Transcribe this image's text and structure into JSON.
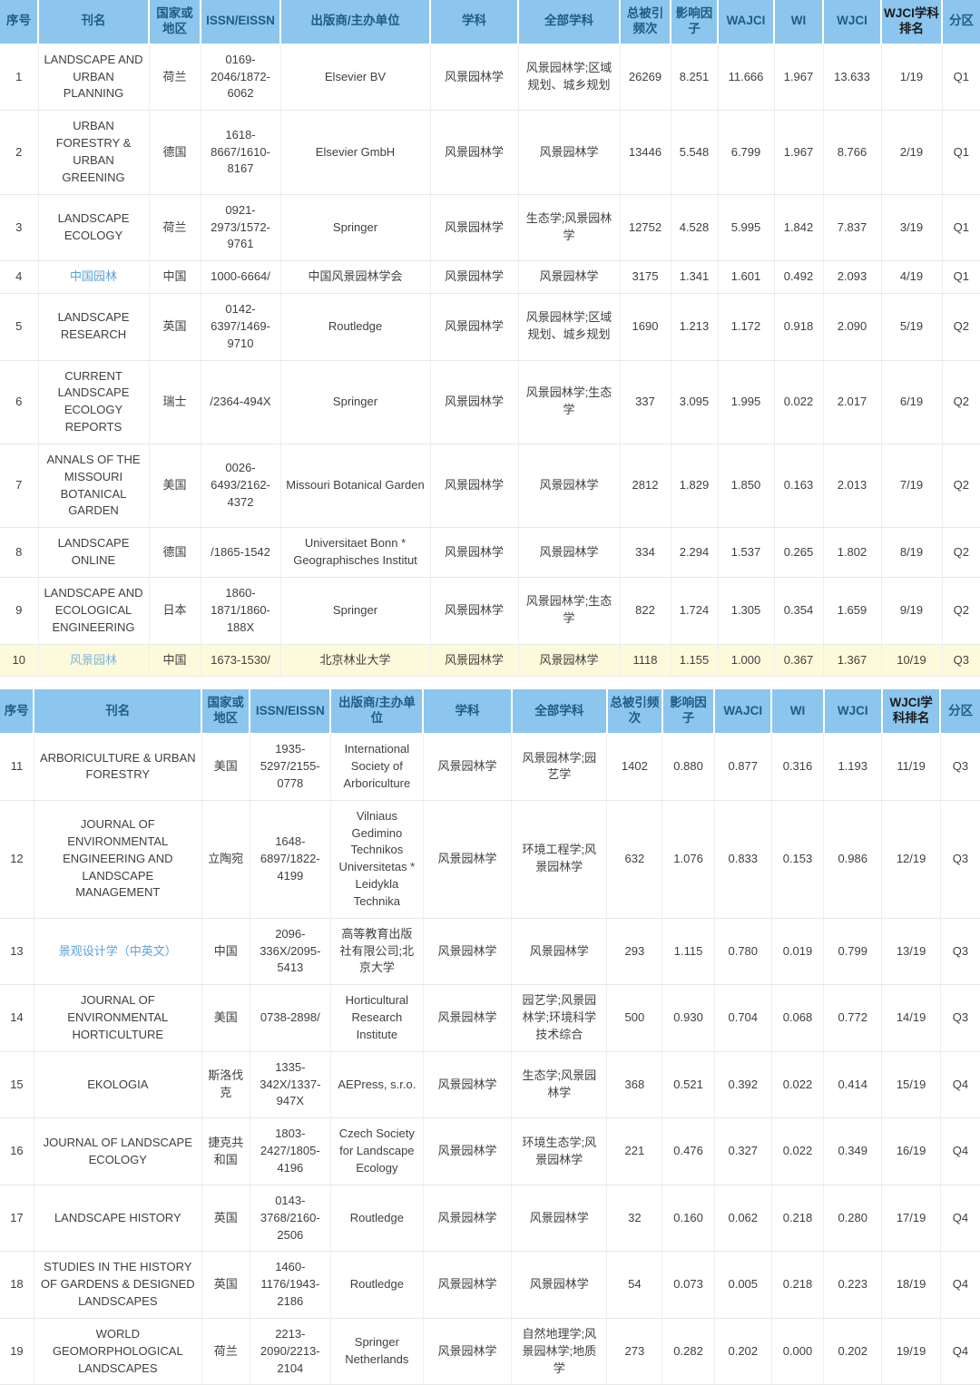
{
  "colors": {
    "header_bg": "#8CC6EE",
    "header_text": "#1F5C86",
    "header_text_dark": "#1a1a1a",
    "journal_link": "#7FB4DC",
    "highlight_row_bg": "#FCFADB",
    "body_text": "#404040",
    "grid_line": "#E8E8E8"
  },
  "tables": [
    {
      "id": "table-part-1",
      "headers": [
        {
          "label": "序号",
          "emphasis": "normal"
        },
        {
          "label": "刊名",
          "emphasis": "normal"
        },
        {
          "label": "国家或地区",
          "emphasis": "normal"
        },
        {
          "label": "ISSN/EISSN",
          "emphasis": "normal"
        },
        {
          "label": "出版商/主办单位",
          "emphasis": "normal"
        },
        {
          "label": "学科",
          "emphasis": "normal"
        },
        {
          "label": "全部学科",
          "emphasis": "normal"
        },
        {
          "label": "总被引频次",
          "emphasis": "normal"
        },
        {
          "label": "影响因子",
          "emphasis": "normal"
        },
        {
          "label": "WAJCI",
          "emphasis": "normal"
        },
        {
          "label": "WI",
          "emphasis": "normal"
        },
        {
          "label": "WJCI",
          "emphasis": "normal"
        },
        {
          "label": "WJCI学科排名",
          "emphasis": "dark"
        },
        {
          "label": "分区",
          "emphasis": "normal"
        }
      ],
      "rows": [
        {
          "highlight": false,
          "rank": "1",
          "journal": "LANDSCAPE AND URBAN PLANNING",
          "journal_lang": "en",
          "country": "荷兰",
          "issn": "0169-2046/1872-6062",
          "publisher": "Elsevier BV",
          "discipline": "风景园林学",
          "all_disciplines": "风景园林学;区域规划、城乡规划",
          "total_citations": "26269",
          "impact_factor": "8.251",
          "wajci": "11.666",
          "wi": "1.967",
          "wjci": "13.633",
          "wjci_rank": "1/19",
          "quartile": "Q1"
        },
        {
          "highlight": false,
          "rank": "2",
          "journal": "URBAN FORESTRY & URBAN GREENING",
          "journal_lang": "en",
          "country": "德国",
          "issn": "1618-8667/1610-8167",
          "publisher": "Elsevier GmbH",
          "discipline": "风景园林学",
          "all_disciplines": "风景园林学",
          "total_citations": "13446",
          "impact_factor": "5.548",
          "wajci": "6.799",
          "wi": "1.967",
          "wjci": "8.766",
          "wjci_rank": "2/19",
          "quartile": "Q1"
        },
        {
          "highlight": false,
          "rank": "3",
          "journal": "LANDSCAPE ECOLOGY",
          "journal_lang": "en",
          "country": "荷兰",
          "issn": "0921-2973/1572-9761",
          "publisher": "Springer",
          "discipline": "风景园林学",
          "all_disciplines": "生态学;风景园林学",
          "total_citations": "12752",
          "impact_factor": "4.528",
          "wajci": "5.995",
          "wi": "1.842",
          "wjci": "7.837",
          "wjci_rank": "3/19",
          "quartile": "Q1"
        },
        {
          "highlight": false,
          "rank": "4",
          "journal": "中国园林",
          "journal_lang": "cn",
          "country": "中国",
          "issn": "1000-6664/",
          "publisher": "中国风景园林学会",
          "discipline": "风景园林学",
          "all_disciplines": "风景园林学",
          "total_citations": "3175",
          "impact_factor": "1.341",
          "wajci": "1.601",
          "wi": "0.492",
          "wjci": "2.093",
          "wjci_rank": "4/19",
          "quartile": "Q1"
        },
        {
          "highlight": false,
          "rank": "5",
          "journal": "LANDSCAPE RESEARCH",
          "journal_lang": "en",
          "country": "英国",
          "issn": "0142-6397/1469-9710",
          "publisher": "Routledge",
          "discipline": "风景园林学",
          "all_disciplines": "风景园林学;区域规划、城乡规划",
          "total_citations": "1690",
          "impact_factor": "1.213",
          "wajci": "1.172",
          "wi": "0.918",
          "wjci": "2.090",
          "wjci_rank": "5/19",
          "quartile": "Q2"
        },
        {
          "highlight": false,
          "rank": "6",
          "journal": "CURRENT LANDSCAPE ECOLOGY REPORTS",
          "journal_lang": "en",
          "country": "瑞士",
          "issn": "/2364-494X",
          "publisher": "Springer",
          "discipline": "风景园林学",
          "all_disciplines": "风景园林学;生态学",
          "total_citations": "337",
          "impact_factor": "3.095",
          "wajci": "1.995",
          "wi": "0.022",
          "wjci": "2.017",
          "wjci_rank": "6/19",
          "quartile": "Q2"
        },
        {
          "highlight": false,
          "rank": "7",
          "journal": "ANNALS OF THE MISSOURI BOTANICAL GARDEN",
          "journal_lang": "en",
          "country": "美国",
          "issn": "0026-6493/2162-4372",
          "publisher": "Missouri Botanical Garden",
          "discipline": "风景园林学",
          "all_disciplines": "风景园林学",
          "total_citations": "2812",
          "impact_factor": "1.829",
          "wajci": "1.850",
          "wi": "0.163",
          "wjci": "2.013",
          "wjci_rank": "7/19",
          "quartile": "Q2"
        },
        {
          "highlight": false,
          "rank": "8",
          "journal": "LANDSCAPE ONLINE",
          "journal_lang": "en",
          "country": "德国",
          "issn": "/1865-1542",
          "publisher": "Universitaet Bonn * Geographisches Institut",
          "discipline": "风景园林学",
          "all_disciplines": "风景园林学",
          "total_citations": "334",
          "impact_factor": "2.294",
          "wajci": "1.537",
          "wi": "0.265",
          "wjci": "1.802",
          "wjci_rank": "8/19",
          "quartile": "Q2"
        },
        {
          "highlight": false,
          "rank": "9",
          "journal": "LANDSCAPE AND ECOLOGICAL ENGINEERING",
          "journal_lang": "en",
          "country": "日本",
          "issn": "1860-1871/1860-188X",
          "publisher": "Springer",
          "discipline": "风景园林学",
          "all_disciplines": "风景园林学;生态学",
          "total_citations": "822",
          "impact_factor": "1.724",
          "wajci": "1.305",
          "wi": "0.354",
          "wjci": "1.659",
          "wjci_rank": "9/19",
          "quartile": "Q2"
        },
        {
          "highlight": true,
          "rank": "10",
          "journal": "风景园林",
          "journal_lang": "cn",
          "country": "中国",
          "issn": "1673-1530/",
          "publisher": "北京林业大学",
          "discipline": "风景园林学",
          "all_disciplines": "风景园林学",
          "total_citations": "1118",
          "impact_factor": "1.155",
          "wajci": "1.000",
          "wi": "0.367",
          "wjci": "1.367",
          "wjci_rank": "10/19",
          "quartile": "Q3"
        }
      ]
    },
    {
      "id": "table-part-2",
      "headers": [
        {
          "label": "序号",
          "emphasis": "normal"
        },
        {
          "label": "刊名",
          "emphasis": "normal"
        },
        {
          "label": "国家或地区",
          "emphasis": "normal"
        },
        {
          "label": "ISSN/EISSN",
          "emphasis": "normal"
        },
        {
          "label": "出版商/主办单位",
          "emphasis": "normal"
        },
        {
          "label": "学科",
          "emphasis": "normal"
        },
        {
          "label": "全部学科",
          "emphasis": "normal"
        },
        {
          "label": "总被引频次",
          "emphasis": "normal"
        },
        {
          "label": "影响因子",
          "emphasis": "normal"
        },
        {
          "label": "WAJCI",
          "emphasis": "normal"
        },
        {
          "label": "WI",
          "emphasis": "normal"
        },
        {
          "label": "WJCI",
          "emphasis": "normal"
        },
        {
          "label": "WJCI学科排名",
          "emphasis": "dark"
        },
        {
          "label": "分区",
          "emphasis": "normal"
        }
      ],
      "rows": [
        {
          "highlight": false,
          "rank": "11",
          "journal": "ARBORICULTURE & URBAN FORESTRY",
          "journal_lang": "en",
          "country": "美国",
          "issn": "1935-5297/2155-0778",
          "publisher": "International Society of Arboriculture",
          "discipline": "风景园林学",
          "all_disciplines": "风景园林学;园艺学",
          "total_citations": "1402",
          "impact_factor": "0.880",
          "wajci": "0.877",
          "wi": "0.316",
          "wjci": "1.193",
          "wjci_rank": "11/19",
          "quartile": "Q3"
        },
        {
          "highlight": false,
          "rank": "12",
          "journal": "JOURNAL OF ENVIRONMENTAL ENGINEERING AND LANDSCAPE MANAGEMENT",
          "journal_lang": "en",
          "country": "立陶宛",
          "issn": "1648-6897/1822-4199",
          "publisher": "Vilniaus Gedimino Technikos Universitetas * Leidykla Technika",
          "discipline": "风景园林学",
          "all_disciplines": "环境工程学;风景园林学",
          "total_citations": "632",
          "impact_factor": "1.076",
          "wajci": "0.833",
          "wi": "0.153",
          "wjci": "0.986",
          "wjci_rank": "12/19",
          "quartile": "Q3"
        },
        {
          "highlight": false,
          "rank": "13",
          "journal": "景观设计学（中英文）",
          "journal_lang": "cn",
          "country": "中国",
          "issn": "2096-336X/2095-5413",
          "publisher": "高等教育出版社有限公司;北京大学",
          "discipline": "风景园林学",
          "all_disciplines": "风景园林学",
          "total_citations": "293",
          "impact_factor": "1.115",
          "wajci": "0.780",
          "wi": "0.019",
          "wjci": "0.799",
          "wjci_rank": "13/19",
          "quartile": "Q3"
        },
        {
          "highlight": false,
          "rank": "14",
          "journal": "JOURNAL OF ENVIRONMENTAL HORTICULTURE",
          "journal_lang": "en",
          "country": "美国",
          "issn": "0738-2898/",
          "publisher": "Horticultural Research Institute",
          "discipline": "风景园林学",
          "all_disciplines": "园艺学;风景园林学;环境科学技术综合",
          "total_citations": "500",
          "impact_factor": "0.930",
          "wajci": "0.704",
          "wi": "0.068",
          "wjci": "0.772",
          "wjci_rank": "14/19",
          "quartile": "Q3"
        },
        {
          "highlight": false,
          "rank": "15",
          "journal": "EKOLOGIA",
          "journal_lang": "en",
          "country": "斯洛伐克",
          "issn": "1335-342X/1337-947X",
          "publisher": "AEPress, s.r.o.",
          "discipline": "风景园林学",
          "all_disciplines": "生态学;风景园林学",
          "total_citations": "368",
          "impact_factor": "0.521",
          "wajci": "0.392",
          "wi": "0.022",
          "wjci": "0.414",
          "wjci_rank": "15/19",
          "quartile": "Q4"
        },
        {
          "highlight": false,
          "rank": "16",
          "journal": "JOURNAL OF LANDSCAPE ECOLOGY",
          "journal_lang": "en",
          "country": "捷克共和国",
          "issn": "1803-2427/1805-4196",
          "publisher": "Czech Society for Landscape Ecology",
          "discipline": "风景园林学",
          "all_disciplines": "环境生态学;风景园林学",
          "total_citations": "221",
          "impact_factor": "0.476",
          "wajci": "0.327",
          "wi": "0.022",
          "wjci": "0.349",
          "wjci_rank": "16/19",
          "quartile": "Q4"
        },
        {
          "highlight": false,
          "rank": "17",
          "journal": "LANDSCAPE HISTORY",
          "journal_lang": "en",
          "country": "英国",
          "issn": "0143-3768/2160-2506",
          "publisher": "Routledge",
          "discipline": "风景园林学",
          "all_disciplines": "风景园林学",
          "total_citations": "32",
          "impact_factor": "0.160",
          "wajci": "0.062",
          "wi": "0.218",
          "wjci": "0.280",
          "wjci_rank": "17/19",
          "quartile": "Q4"
        },
        {
          "highlight": false,
          "rank": "18",
          "journal": "STUDIES IN THE HISTORY OF GARDENS & DESIGNED LANDSCAPES",
          "journal_lang": "en",
          "country": "英国",
          "issn": "1460-1176/1943-2186",
          "publisher": "Routledge",
          "discipline": "风景园林学",
          "all_disciplines": "风景园林学",
          "total_citations": "54",
          "impact_factor": "0.073",
          "wajci": "0.005",
          "wi": "0.218",
          "wjci": "0.223",
          "wjci_rank": "18/19",
          "quartile": "Q4"
        },
        {
          "highlight": false,
          "rank": "19",
          "journal": "WORLD GEOMORPHOLOGICAL LANDSCAPES",
          "journal_lang": "en",
          "country": "荷兰",
          "issn": "2213-2090/2213-2104",
          "publisher": "Springer Netherlands",
          "discipline": "风景园林学",
          "all_disciplines": "自然地理学;风景园林学;地质学",
          "total_citations": "273",
          "impact_factor": "0.282",
          "wajci": "0.202",
          "wi": "0.000",
          "wjci": "0.202",
          "wjci_rank": "19/19",
          "quartile": "Q4"
        }
      ]
    }
  ]
}
